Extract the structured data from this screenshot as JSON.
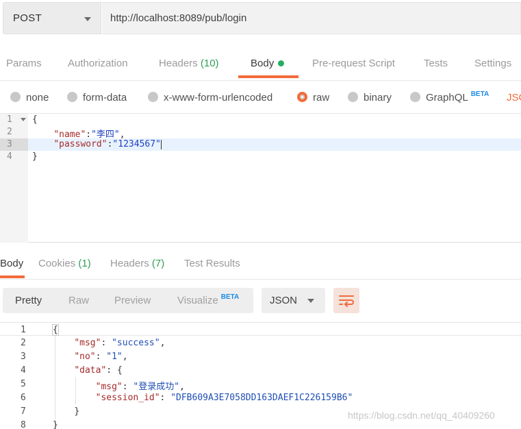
{
  "request": {
    "method": "POST",
    "url": "http://localhost:8089/pub/login",
    "tabs": [
      {
        "label": "Params"
      },
      {
        "label": "Authorization"
      },
      {
        "label": "Headers",
        "count": "(10)"
      },
      {
        "label": "Body"
      },
      {
        "label": "Pre-request Script"
      },
      {
        "label": "Tests"
      },
      {
        "label": "Settings"
      }
    ],
    "body_types": [
      {
        "label": "none"
      },
      {
        "label": "form-data"
      },
      {
        "label": "x-www-form-urlencoded"
      },
      {
        "label": "raw"
      },
      {
        "label": "binary"
      },
      {
        "label": "GraphQL",
        "badge": "BETA"
      }
    ],
    "body_format_partial": "JSC",
    "editor_lines": [
      {
        "num": "1",
        "text": "{"
      },
      {
        "num": "2",
        "key": "\"name\"",
        "sep": ":",
        "value": "\"李四\"",
        "end": ","
      },
      {
        "num": "3",
        "key": "\"password\"",
        "sep": ":",
        "value": "\"1234567\""
      },
      {
        "num": "4",
        "text": "}"
      }
    ]
  },
  "response": {
    "tabs": [
      {
        "label": "Body"
      },
      {
        "label": "Cookies",
        "count": "(1)"
      },
      {
        "label": "Headers",
        "count": "(7)"
      },
      {
        "label": "Test Results"
      }
    ],
    "views": [
      {
        "label": "Pretty"
      },
      {
        "label": "Raw"
      },
      {
        "label": "Preview"
      },
      {
        "label": "Visualize",
        "badge": "BETA"
      }
    ],
    "format": "JSON",
    "lines": [
      {
        "num": "1",
        "text": "{"
      },
      {
        "num": "2",
        "key": "\"msg\"",
        "sep": ": ",
        "value": "\"success\"",
        "end": ","
      },
      {
        "num": "3",
        "key": "\"no\"",
        "sep": ": ",
        "value": "\"1\"",
        "end": ","
      },
      {
        "num": "4",
        "key": "\"data\"",
        "sep": ": ",
        "text_after": "{"
      },
      {
        "num": "5",
        "key": "\"msg\"",
        "sep": ": ",
        "value": "\"登录成功\"",
        "end": ","
      },
      {
        "num": "6",
        "key": "\"session_id\"",
        "sep": ": ",
        "value": "\"DFB609A3E7058DD163DAEF1C226159B6\""
      },
      {
        "num": "7",
        "text": "}"
      },
      {
        "num": "8",
        "text": "}"
      }
    ]
  },
  "watermark": "https://blog.csdn.net/qq_40409260",
  "colors": {
    "accent": "#f26b3a",
    "green": "#27ae60",
    "beta": "#1a8ae6"
  },
  "icons": {
    "method_dropdown": "chevron-down-icon",
    "wrap": "wrap-lines-icon"
  }
}
